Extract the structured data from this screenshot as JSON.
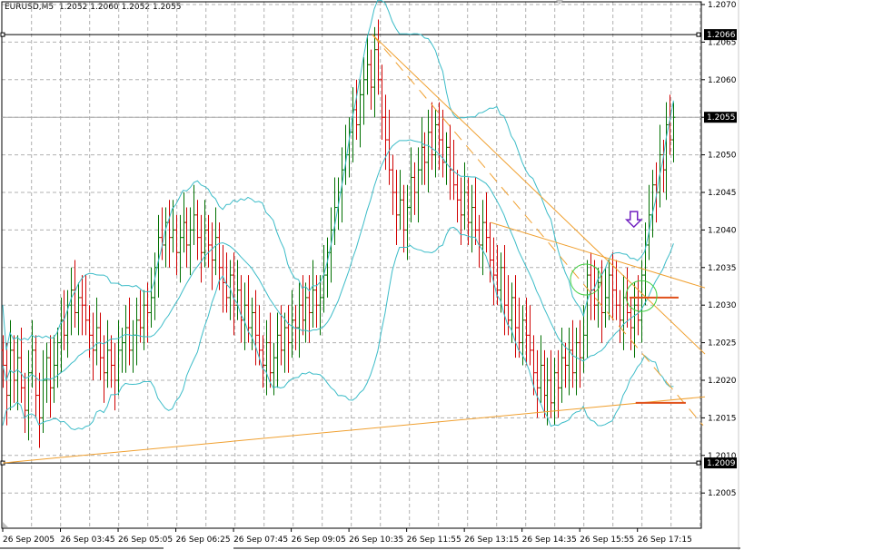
{
  "header": {
    "symbol": "EURUSD,M5",
    "open": "1.2052",
    "high": "1.2060",
    "low": "1.2052",
    "close": "1.2055"
  },
  "chart_data": {
    "type": "ohlc",
    "title": "EURUSD,M5",
    "price_base": 1.2,
    "pip": 0.0001,
    "ylim": [
      1.2,
      1.2072
    ],
    "grid": true,
    "y_ticks": [
      "1.2070",
      "1.2065",
      "1.2060",
      "1.2055",
      "1.2050",
      "1.2045",
      "1.2040",
      "1.2035",
      "1.2030",
      "1.2025",
      "1.2020",
      "1.2015",
      "1.2010",
      "1.2005"
    ],
    "x_ticks": [
      {
        "bar": 0,
        "label": "26 Sep 2005"
      },
      {
        "bar": 16,
        "label": "26 Sep 03:45"
      },
      {
        "bar": 32,
        "label": "26 Sep 05:05"
      },
      {
        "bar": 48,
        "label": "26 Sep 06:25"
      },
      {
        "bar": 64,
        "label": "26 Sep 07:45"
      },
      {
        "bar": 80,
        "label": "26 Sep 09:05"
      },
      {
        "bar": 96,
        "label": "26 Sep 10:35"
      },
      {
        "bar": 112,
        "label": "26 Sep 11:55"
      },
      {
        "bar": 128,
        "label": "26 Sep 13:15"
      },
      {
        "bar": 144,
        "label": "26 Sep 14:35"
      },
      {
        "bar": 160,
        "label": "26 Sep 15:55"
      },
      {
        "bar": 176,
        "label": "26 Sep 17:15"
      }
    ],
    "close_pips": [
      22,
      18,
      24,
      20,
      23,
      19,
      16,
      21,
      24,
      18,
      15,
      20,
      23,
      19,
      22,
      25,
      28,
      26,
      30,
      32,
      29,
      31,
      30,
      28,
      26,
      24,
      27,
      23,
      21,
      24,
      22,
      20,
      24,
      25,
      27,
      24,
      26,
      28,
      27,
      30,
      29,
      31,
      35,
      39,
      38,
      41,
      39,
      40,
      37,
      39,
      41,
      38,
      40,
      42,
      39,
      37,
      40,
      38,
      36,
      39,
      35,
      33,
      31,
      34,
      30,
      32,
      28,
      30,
      27,
      29,
      26,
      24,
      22,
      25,
      21,
      23,
      26,
      24,
      27,
      25,
      28,
      27,
      30,
      28,
      31,
      29,
      32,
      30,
      31,
      34,
      37,
      40,
      43,
      45,
      48,
      50,
      53,
      56,
      54,
      58,
      60,
      62,
      59,
      64,
      60,
      55,
      52,
      48,
      45,
      42,
      44,
      40,
      43,
      47,
      45,
      48,
      51,
      49,
      53,
      50,
      54,
      52,
      49,
      51,
      48,
      46,
      44,
      42,
      45,
      41,
      43,
      40,
      38,
      41,
      39,
      36,
      34,
      32,
      35,
      30,
      28,
      31,
      27,
      25,
      28,
      26,
      24,
      21,
      19,
      22,
      18,
      20,
      17,
      21,
      19,
      23,
      22,
      24,
      21,
      25,
      23,
      26,
      34,
      32,
      30,
      33,
      29,
      31,
      34,
      32,
      30,
      28,
      31,
      29,
      27,
      30,
      28,
      34,
      38,
      42,
      46,
      45,
      50,
      48,
      54,
      52,
      55
    ],
    "indicator": {
      "name": "Bollinger Bands",
      "period": 20,
      "deviation": 2
    },
    "horizontal_lines": [
      {
        "price": 1.2066,
        "label": "1.2066"
      },
      {
        "price": 1.2009,
        "label": "1.2009"
      }
    ],
    "current_price": {
      "price": 1.2055,
      "label": "1.2055"
    },
    "trendlines": [
      {
        "from": [
          0,
          1.2009
        ],
        "to": [
          194.7,
          1.20178
        ],
        "style": "solid"
      },
      {
        "from": [
          102.5,
          1.2066
        ],
        "to": [
          194.7,
          1.20235
        ],
        "style": "solid"
      },
      {
        "from": [
          135.3,
          1.2041
        ],
        "to": [
          194.7,
          1.20323
        ],
        "style": "solid"
      },
      {
        "from": [
          102.5,
          1.2066
        ],
        "to": [
          194.2,
          1.2014
        ],
        "style": "dashed"
      }
    ],
    "levels": [
      {
        "from_bar": 173.8,
        "to_bar": 187.4,
        "price": 1.2031
      },
      {
        "from_bar": 175.5,
        "to_bar": 189.4,
        "price": 1.2017
      }
    ],
    "circles": [
      {
        "bar": 161.7,
        "price": 1.20334
      },
      {
        "bar": 177.1,
        "price": 1.20312
      }
    ],
    "arrow": {
      "bar": 175,
      "price": 1.2041,
      "direction": "down"
    }
  },
  "colors": {
    "up": "#007000",
    "down": "#d00000",
    "doji": "#000000",
    "band": "#3cbcc8",
    "trend": "#f0a030",
    "level": "#e0501a",
    "circle": "#40d040",
    "arrow": "#7020c0",
    "grid": "#b0b0b0"
  }
}
